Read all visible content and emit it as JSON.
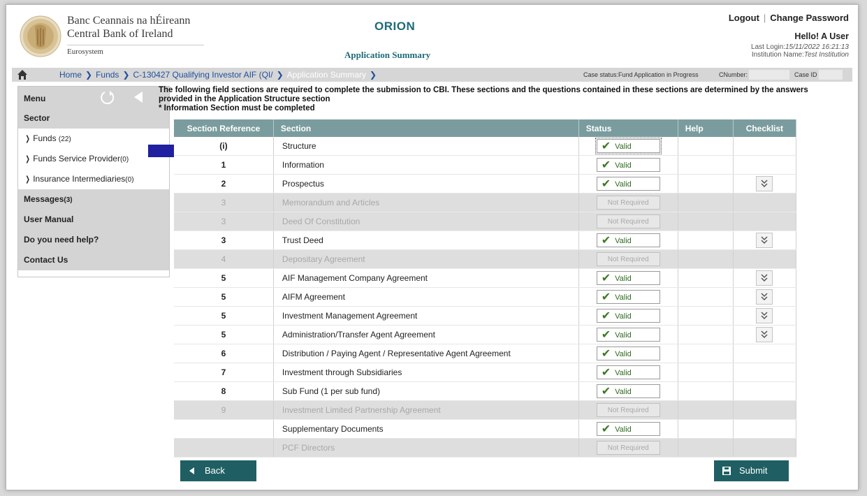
{
  "header": {
    "bank_line1": "Banc Ceannais na hÉireann",
    "bank_line2": "Central Bank of Ireland",
    "bank_line3": "Eurosystem",
    "app_title": "ORION",
    "page_subtitle": "Application Summary",
    "logout": "Logout",
    "separator": "|",
    "change_password": "Change Password",
    "hello": "Hello! A User",
    "last_login_label": "Last Login:",
    "last_login_value": "15/11/2022 16:21:13",
    "institution_label": "Institution Name:",
    "institution_value": "Test Institution"
  },
  "breadcrumb": {
    "items": [
      "Home",
      "Funds",
      "C-130427 Qualifying Investor AIF (QI/",
      "Application Summary"
    ],
    "case_status": "Case status:Fund Application in Progress",
    "cnumber_label": "CNumber:",
    "caseid_label": "Case ID"
  },
  "sidebar": {
    "menu_label": "Menu",
    "sector_label": "Sector",
    "sectors": [
      {
        "label": "Funds",
        "count": "(22)"
      },
      {
        "label": "Funds Service Provider",
        "count": "(0)"
      },
      {
        "label": "Insurance Intermediaries",
        "count": "(0)"
      }
    ],
    "messages_label": "Messages",
    "messages_count": "(3)",
    "user_manual": "User Manual",
    "help": "Do you need help?",
    "contact": "Contact Us"
  },
  "intro": {
    "line1": "The following field sections are required to complete the submission to CBI. These sections and the questions contained in these sections are determined by the answers",
    "line2": "provided in the Application Structure section",
    "line3": "* Information Section must be completed"
  },
  "table": {
    "headers": [
      "Section Reference",
      "Section",
      "Status",
      "Help",
      "Checklist"
    ],
    "status_valid": "Valid",
    "status_not_required": "Not Required",
    "rows": [
      {
        "ref": "(i)",
        "section": "Structure",
        "status": "valid",
        "checklist": false,
        "selected": true
      },
      {
        "ref": "1",
        "section": "Information",
        "status": "valid",
        "checklist": false
      },
      {
        "ref": "2",
        "section": "Prospectus",
        "status": "valid",
        "checklist": true
      },
      {
        "ref": "3",
        "section": "Memorandum and Articles",
        "status": "not_required",
        "checklist": false
      },
      {
        "ref": "3",
        "section": "Deed Of Constitution",
        "status": "not_required",
        "checklist": false
      },
      {
        "ref": "3",
        "section": "Trust Deed",
        "status": "valid",
        "checklist": true
      },
      {
        "ref": "4",
        "section": "Depositary Agreement",
        "status": "not_required",
        "checklist": false
      },
      {
        "ref": "5",
        "section": "AIF Management Company Agreement",
        "status": "valid",
        "checklist": true
      },
      {
        "ref": "5",
        "section": "AIFM Agreement",
        "status": "valid",
        "checklist": true
      },
      {
        "ref": "5",
        "section": "Investment Management Agreement",
        "status": "valid",
        "checklist": true
      },
      {
        "ref": "5",
        "section": "Administration/Transfer Agent Agreement",
        "status": "valid",
        "checklist": true
      },
      {
        "ref": "6",
        "section": "Distribution / Paying Agent / Representative Agent Agreement",
        "status": "valid",
        "checklist": false
      },
      {
        "ref": "7",
        "section": "Investment through Subsidiaries",
        "status": "valid",
        "checklist": false
      },
      {
        "ref": "8",
        "section": "Sub Fund (1 per sub fund)",
        "status": "valid",
        "checklist": false
      },
      {
        "ref": "9",
        "section": "Investment Limited Partnership Agreement",
        "status": "not_required",
        "checklist": false
      },
      {
        "ref": "",
        "section": "Supplementary Documents",
        "status": "valid",
        "checklist": false
      },
      {
        "ref": "",
        "section": "PCF Directors",
        "status": "not_required",
        "checklist": false
      }
    ]
  },
  "buttons": {
    "back": "Back",
    "submit": "Submit"
  },
  "colors": {
    "accent_teal": "#1e6b78",
    "table_header": "#7b9c9e",
    "button": "#1f5f63",
    "valid_green": "#2d6b1d"
  }
}
